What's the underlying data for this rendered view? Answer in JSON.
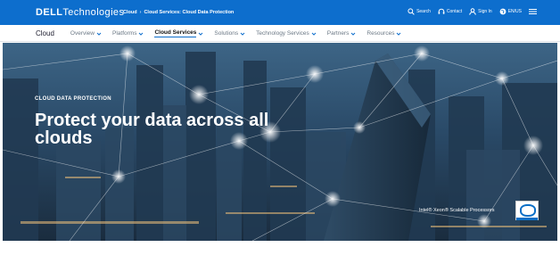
{
  "brand": {
    "logo_bold": "DELL",
    "logo_light": "Technologies"
  },
  "breadcrumb": [
    "Cloud",
    "Cloud Services: Cloud Data Protection"
  ],
  "utility": [
    {
      "label": "Search",
      "icon": "search-icon"
    },
    {
      "label": "Contact",
      "icon": "headset-icon"
    },
    {
      "label": "Sign In",
      "icon": "user-icon"
    },
    {
      "label": "EN/US",
      "icon": "globe-icon"
    }
  ],
  "subnav": {
    "section": "Cloud",
    "items": [
      {
        "label": "Overview",
        "active": false
      },
      {
        "label": "Platforms",
        "active": false
      },
      {
        "label": "Cloud Services",
        "active": true
      },
      {
        "label": "Solutions",
        "active": false
      },
      {
        "label": "Technology Services",
        "active": false
      },
      {
        "label": "Partners",
        "active": false
      },
      {
        "label": "Resources",
        "active": false
      }
    ]
  },
  "hero": {
    "eyebrow": "CLOUD DATA PROTECTION",
    "headline": "Protect your data across all clouds",
    "chip_text": "Intel® Xeon® Scalable Processors"
  },
  "colors": {
    "brand_blue": "#0d6ecd",
    "hero_bg": "#1e3a5a"
  }
}
